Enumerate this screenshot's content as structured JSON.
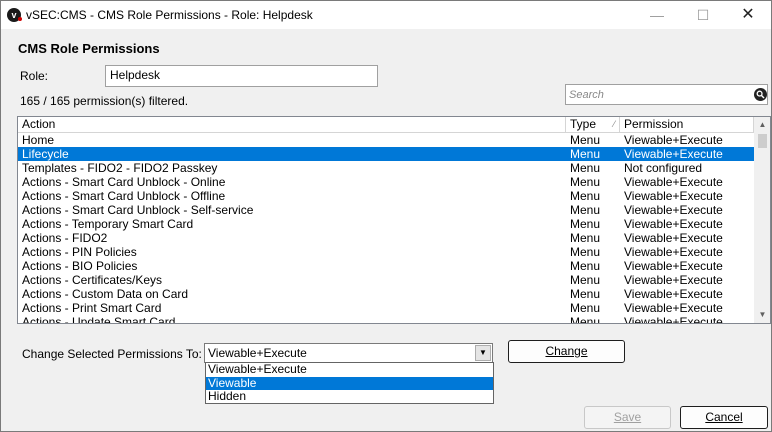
{
  "window": {
    "title": "vSEC:CMS - CMS Role Permissions - Role: Helpdesk",
    "min_glyph": "—",
    "max_glyph": "☐",
    "close_glyph": "✕"
  },
  "header": {
    "title": "CMS Role Permissions",
    "role_label": "Role:",
    "role_value": "Helpdesk",
    "filter_count": "165 / 165 permission(s) filtered."
  },
  "search": {
    "placeholder": "Search",
    "value": ""
  },
  "table": {
    "columns": [
      "Action",
      "Type",
      "Permission"
    ],
    "selected_index": 1,
    "rows": [
      {
        "action": "Home",
        "type": "Menu",
        "permission": "Viewable+Execute"
      },
      {
        "action": "Lifecycle",
        "type": "Menu",
        "permission": "Viewable+Execute"
      },
      {
        "action": "Templates - FIDO2 - FIDO2 Passkey",
        "type": "Menu",
        "permission": "Not configured"
      },
      {
        "action": "Actions - Smart Card Unblock - Online",
        "type": "Menu",
        "permission": "Viewable+Execute"
      },
      {
        "action": "Actions - Smart Card Unblock - Offline",
        "type": "Menu",
        "permission": "Viewable+Execute"
      },
      {
        "action": "Actions - Smart Card Unblock - Self-service",
        "type": "Menu",
        "permission": "Viewable+Execute"
      },
      {
        "action": "Actions - Temporary Smart Card",
        "type": "Menu",
        "permission": "Viewable+Execute"
      },
      {
        "action": "Actions - FIDO2",
        "type": "Menu",
        "permission": "Viewable+Execute"
      },
      {
        "action": "Actions - PIN Policies",
        "type": "Menu",
        "permission": "Viewable+Execute"
      },
      {
        "action": "Actions - BIO Policies",
        "type": "Menu",
        "permission": "Viewable+Execute"
      },
      {
        "action": "Actions - Certificates/Keys",
        "type": "Menu",
        "permission": "Viewable+Execute"
      },
      {
        "action": "Actions - Custom Data on Card",
        "type": "Menu",
        "permission": "Viewable+Execute"
      },
      {
        "action": "Actions - Print Smart Card",
        "type": "Menu",
        "permission": "Viewable+Execute"
      },
      {
        "action": "Actions - Update Smart Card",
        "type": "Menu",
        "permission": "Viewable+Execute"
      }
    ]
  },
  "change": {
    "label": "Change Selected Permissions To:",
    "selected_value": "Viewable+Execute",
    "options": [
      "Viewable+Execute",
      "Viewable",
      "Hidden"
    ],
    "highlighted_option": 1,
    "button_label": "Change"
  },
  "footer": {
    "save_label": "Save",
    "cancel_label": "Cancel"
  },
  "colors": {
    "selection": "#0078d7",
    "window_bg": "#f0f0f0"
  }
}
